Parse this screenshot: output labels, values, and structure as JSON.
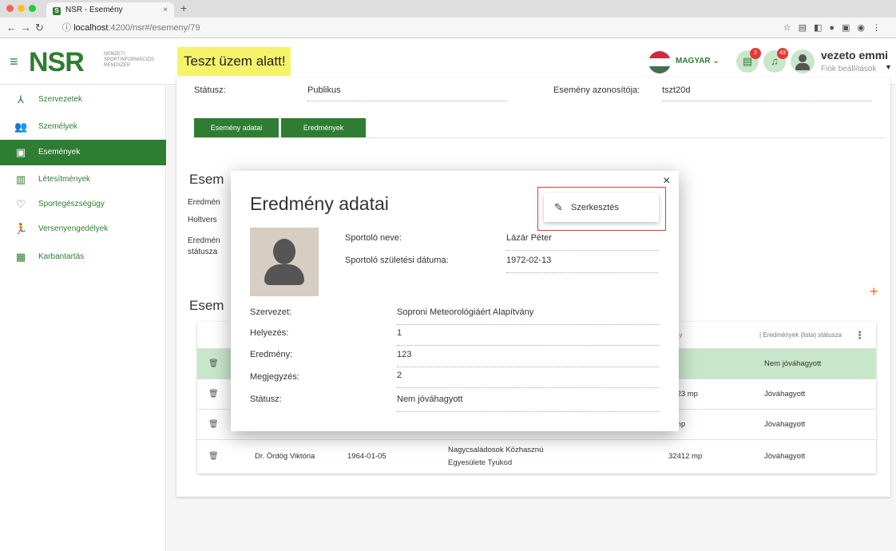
{
  "browser": {
    "tab_title": "NSR - Esemény",
    "tab_favicon": "S",
    "tab_close": "×",
    "new_tab": "+",
    "url_host": "localhost",
    "url_path": ":4200/nsr#/esemeny/79",
    "icons": [
      "back-icon",
      "forward-icon",
      "reload-icon",
      "info-icon",
      "star-icon",
      "extension-icons",
      "profile-icon",
      "menu-icon"
    ]
  },
  "header": {
    "logo": "NSR",
    "logo_sub_1": "NEMZETI",
    "logo_sub_2": "SPORTINFORMÁCIÓS",
    "logo_sub_3": "RENDSZER",
    "test_banner": "Teszt üzem alatt!",
    "language": "MAGYAR ⌄",
    "tasks_badge": "2",
    "notifications_badge": "43",
    "user_name": "vezeto emmi",
    "user_sub": "Fiók beállítások",
    "colors": {
      "brand": "#2e7d32",
      "banner": "#f4f36a",
      "badge": "#e53935"
    }
  },
  "sidebar": {
    "items": [
      {
        "label": "Szervezetek",
        "icon": "organization-icon"
      },
      {
        "label": "Személyek",
        "icon": "people-icon"
      },
      {
        "label": "Események",
        "icon": "calendar-icon",
        "active": true
      },
      {
        "label": "Létesítmények",
        "icon": "building-icon"
      },
      {
        "label": "Sportegészségügy",
        "icon": "heart-icon"
      },
      {
        "label": "Versenyengedélyek",
        "icon": "runner-icon"
      },
      {
        "label": "Karbantartás",
        "icon": "clipboard-icon"
      }
    ]
  },
  "main": {
    "status_label": "Státusz:",
    "status_value": "Publikus",
    "event_id_label": "Esemény azonosítója:",
    "event_id_value": "tszt20d",
    "tabs": [
      "Esemény adatai",
      "Eredmények"
    ],
    "section1_title": "Esem",
    "bg_labels": [
      "Eredmén",
      "Holtvers",
      "Eredmén",
      "státusza"
    ],
    "section2_title": "Esem",
    "add_button": "+",
    "table": {
      "headers": [
        "nény",
        "Eredmények (lista) státusza"
      ],
      "rows": [
        {
          "name": "",
          "date": "",
          "org": "",
          "result": "mp",
          "status": "Nem jóváhagyott"
        },
        {
          "name": "",
          "date": "",
          "org": "",
          "result": "3123 mp",
          "status": "Jóváhagyott"
        },
        {
          "name": "",
          "date": "",
          "org": "",
          "result": "4 mp",
          "status": "Jóváhagyott"
        },
        {
          "name": "Dr. Ördög Viktória",
          "date": "1964-01-05",
          "org_line1": "Nagycsaládosok Közhasznú",
          "org_line2": "Egyesülete Tyukod",
          "result": "32412 mp",
          "status": "Jóváhagyott"
        }
      ]
    }
  },
  "modal": {
    "title": "Eredmény adatai",
    "close": "×",
    "edit_label": "Szerkesztés",
    "athlete_name_label": "Sportoló neve:",
    "athlete_name_value": "Lázár Péter",
    "athlete_birth_label": "Sportoló születési dátuma:",
    "athlete_birth_value": "1972-02-13",
    "fields": [
      {
        "label": "Szervezet:",
        "value": "Soproni Meteorológiáért Alapítvány"
      },
      {
        "label": "Helyezés:",
        "value": "1"
      },
      {
        "label": "Eredmény:",
        "value": "123"
      },
      {
        "label": "Megjegyzés:",
        "value": "2"
      },
      {
        "label": "Státusz:",
        "value": "Nem jóváhagyott"
      }
    ]
  }
}
